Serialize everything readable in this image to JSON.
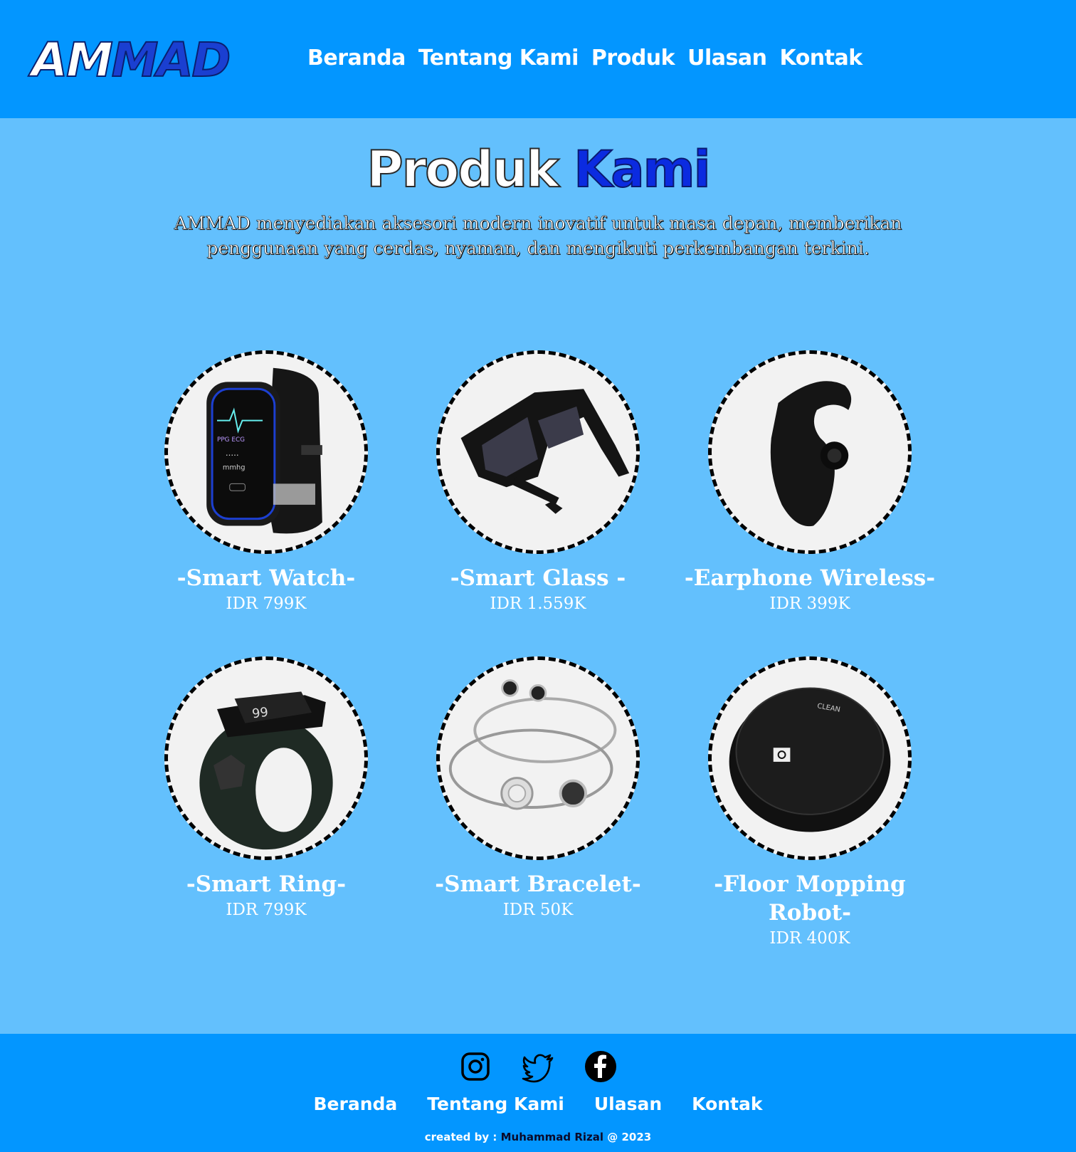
{
  "header": {
    "logo_part1": "AM",
    "logo_part2": "MAD",
    "nav": [
      "Beranda",
      "Tentang Kami",
      "Produk",
      "Ulasan",
      "Kontak"
    ]
  },
  "hero": {
    "title_part1": "Produk",
    "title_part2": "Kami",
    "description": "AMMAD menyediakan aksesori modern inovatif untuk masa depan, memberikan penggunaan yang cerdas, nyaman, dan mengikuti perkembangan terkini."
  },
  "products": [
    {
      "name": "-Smart Watch-",
      "price": "IDR 799K",
      "icon": "smart-watch-image"
    },
    {
      "name": "-Smart Glass -",
      "price": "IDR 1.559K",
      "icon": "smart-glass-image"
    },
    {
      "name": "-Earphone Wireless-",
      "price": "IDR 399K",
      "icon": "earphone-image"
    },
    {
      "name": "-Smart Ring-",
      "price": "IDR 799K",
      "icon": "smart-ring-image"
    },
    {
      "name": "-Smart Bracelet-",
      "price": "IDR 50K",
      "icon": "smart-bracelet-image"
    },
    {
      "name": "-Floor Mopping Robot-",
      "price": "IDR 400K",
      "icon": "robot-vacuum-image"
    }
  ],
  "footer": {
    "socials": [
      "instagram-icon",
      "twitter-icon",
      "facebook-icon"
    ],
    "nav": [
      "Beranda",
      "Tentang Kami",
      "Ulasan",
      "Kontak"
    ],
    "credit_prefix": "created by :",
    "credit_name": "Muhammad Rizal",
    "credit_suffix": "@ 2023"
  },
  "colors": {
    "header_bg": "#0396ff",
    "body_bg": "#63c0fd",
    "accent_blue": "#0b2be0",
    "circle_bg": "#f2f2f2"
  }
}
